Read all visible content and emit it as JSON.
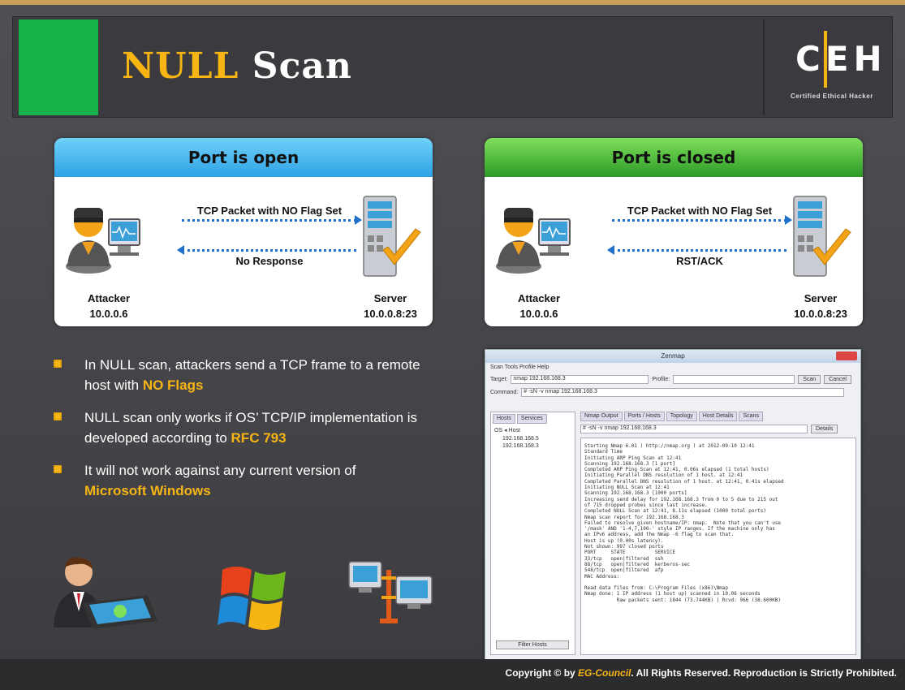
{
  "header": {
    "title_highlight": "NULL",
    "title_rest": " Scan",
    "logo_letters": "CEH",
    "logo_subtitle": "Certified  Ethical  Hacker"
  },
  "panels": [
    {
      "heading": "Port is open",
      "top_arrow_label": "TCP Packet with NO Flag Set",
      "bottom_arrow_label": "No Response",
      "attacker_label": "Attacker",
      "attacker_ip": "10.0.0.6",
      "server_label": "Server",
      "server_ip": "10.0.0.8:23"
    },
    {
      "heading": "Port is closed",
      "top_arrow_label": "TCP Packet with NO Flag Set",
      "bottom_arrow_label": "RST/ACK",
      "attacker_label": "Attacker",
      "attacker_ip": "10.0.0.6",
      "server_label": "Server",
      "server_ip": "10.0.0.8:23"
    }
  ],
  "bullets": [
    {
      "before": "In NULL scan, attackers send a TCP frame to a remote host with ",
      "highlight": "NO Flags",
      "after": ""
    },
    {
      "before": "NULL scan only works  if OS’ TCP/IP implementation is developed according to ",
      "highlight": "RFC 793",
      "after": ""
    },
    {
      "before": "It will not work against any current version of ",
      "highlight": "Microsoft Windows",
      "after": ""
    }
  ],
  "zenmap": {
    "window_title": "Zenmap",
    "menu": "Scan   Tools   Profile   Help",
    "target_label": "Target:",
    "target_value": "nmap 192.168.168.3",
    "profile_label": "Profile:",
    "scan_button": "Scan",
    "cancel_button": "Cancel",
    "command_label": "Command:",
    "command_value": "# -sN -v nmap 192.168.168.3",
    "hosts_tab": "Hosts",
    "services_tab": "Services",
    "os_host_header": "OS  ◂  Host",
    "hosts": [
      "192.168.168.5",
      "192.168.168.3"
    ],
    "filter_button": "Filter Hosts",
    "output_tabs": [
      "Nmap Output",
      "Ports / Hosts",
      "Topology",
      "Host Details",
      "Scans"
    ],
    "output_select": "# -sN -v nmap 192.168.168.3",
    "details_button": "Details",
    "output_text": "Starting Nmap 6.01 ( http://nmap.org ) at 2012-09-10 12:41\nStandard Time\nInitiating ARP Ping Scan at 12:41\nScanning 192.168.168.3 [1 port]\nCompleted ARP Ping Scan at 12:41, 0.06s elapsed (1 total hosts)\nInitiating Parallel DNS resolution of 1 host. at 12:41\nCompleted Parallel DNS resolution of 1 host. at 12:41, 0.41s elapsed\nInitiating NULL Scan at 12:41\nScanning 192.168.168.3 [1000 ports]\nIncreasing send delay for 192.168.168.3 from 0 to 5 due to 215 out\nof 715 dropped probes since last increase.\nCompleted NULL Scan at 12:41, 8.11s elapsed (1000 total ports)\nNmap scan report for 192.168.168.3\nFailed to resolve given hostname/IP: nmap.  Note that you can't use\n'/mask' AND '1-4,7,100-' style IP ranges. If the machine only has\nan IPv6 address, add the Nmap -6 flag to scan that.\nHost is up (0.00s latency).\nNot shown: 997 closed ports\nPORT     STATE          SERVICE\n33/tcp   open|filtered  ssh\n88/tcp   open|filtered  kerberos-sec\n548/tcp  open|filtered  afp\nMAC Address:\n\nRead data files from: C:\\Program Files (x86)\\Nmap\nNmap done: 1 IP address (1 host up) scanned in 10.06 seconds\n           Raw packets sent: 1844 (73.744KB) | Rcvd: 966 (38.600KB)"
  },
  "footer": {
    "copyright_before": "Copyright © by ",
    "brand": "EG-Council",
    "copyright_after": ". All Rights Reserved. Reproduction is Strictly Prohibited."
  },
  "colors": {
    "accent_yellow": "#f7b514",
    "green": "#18b24a",
    "arrow_blue": "#1f70c8"
  }
}
